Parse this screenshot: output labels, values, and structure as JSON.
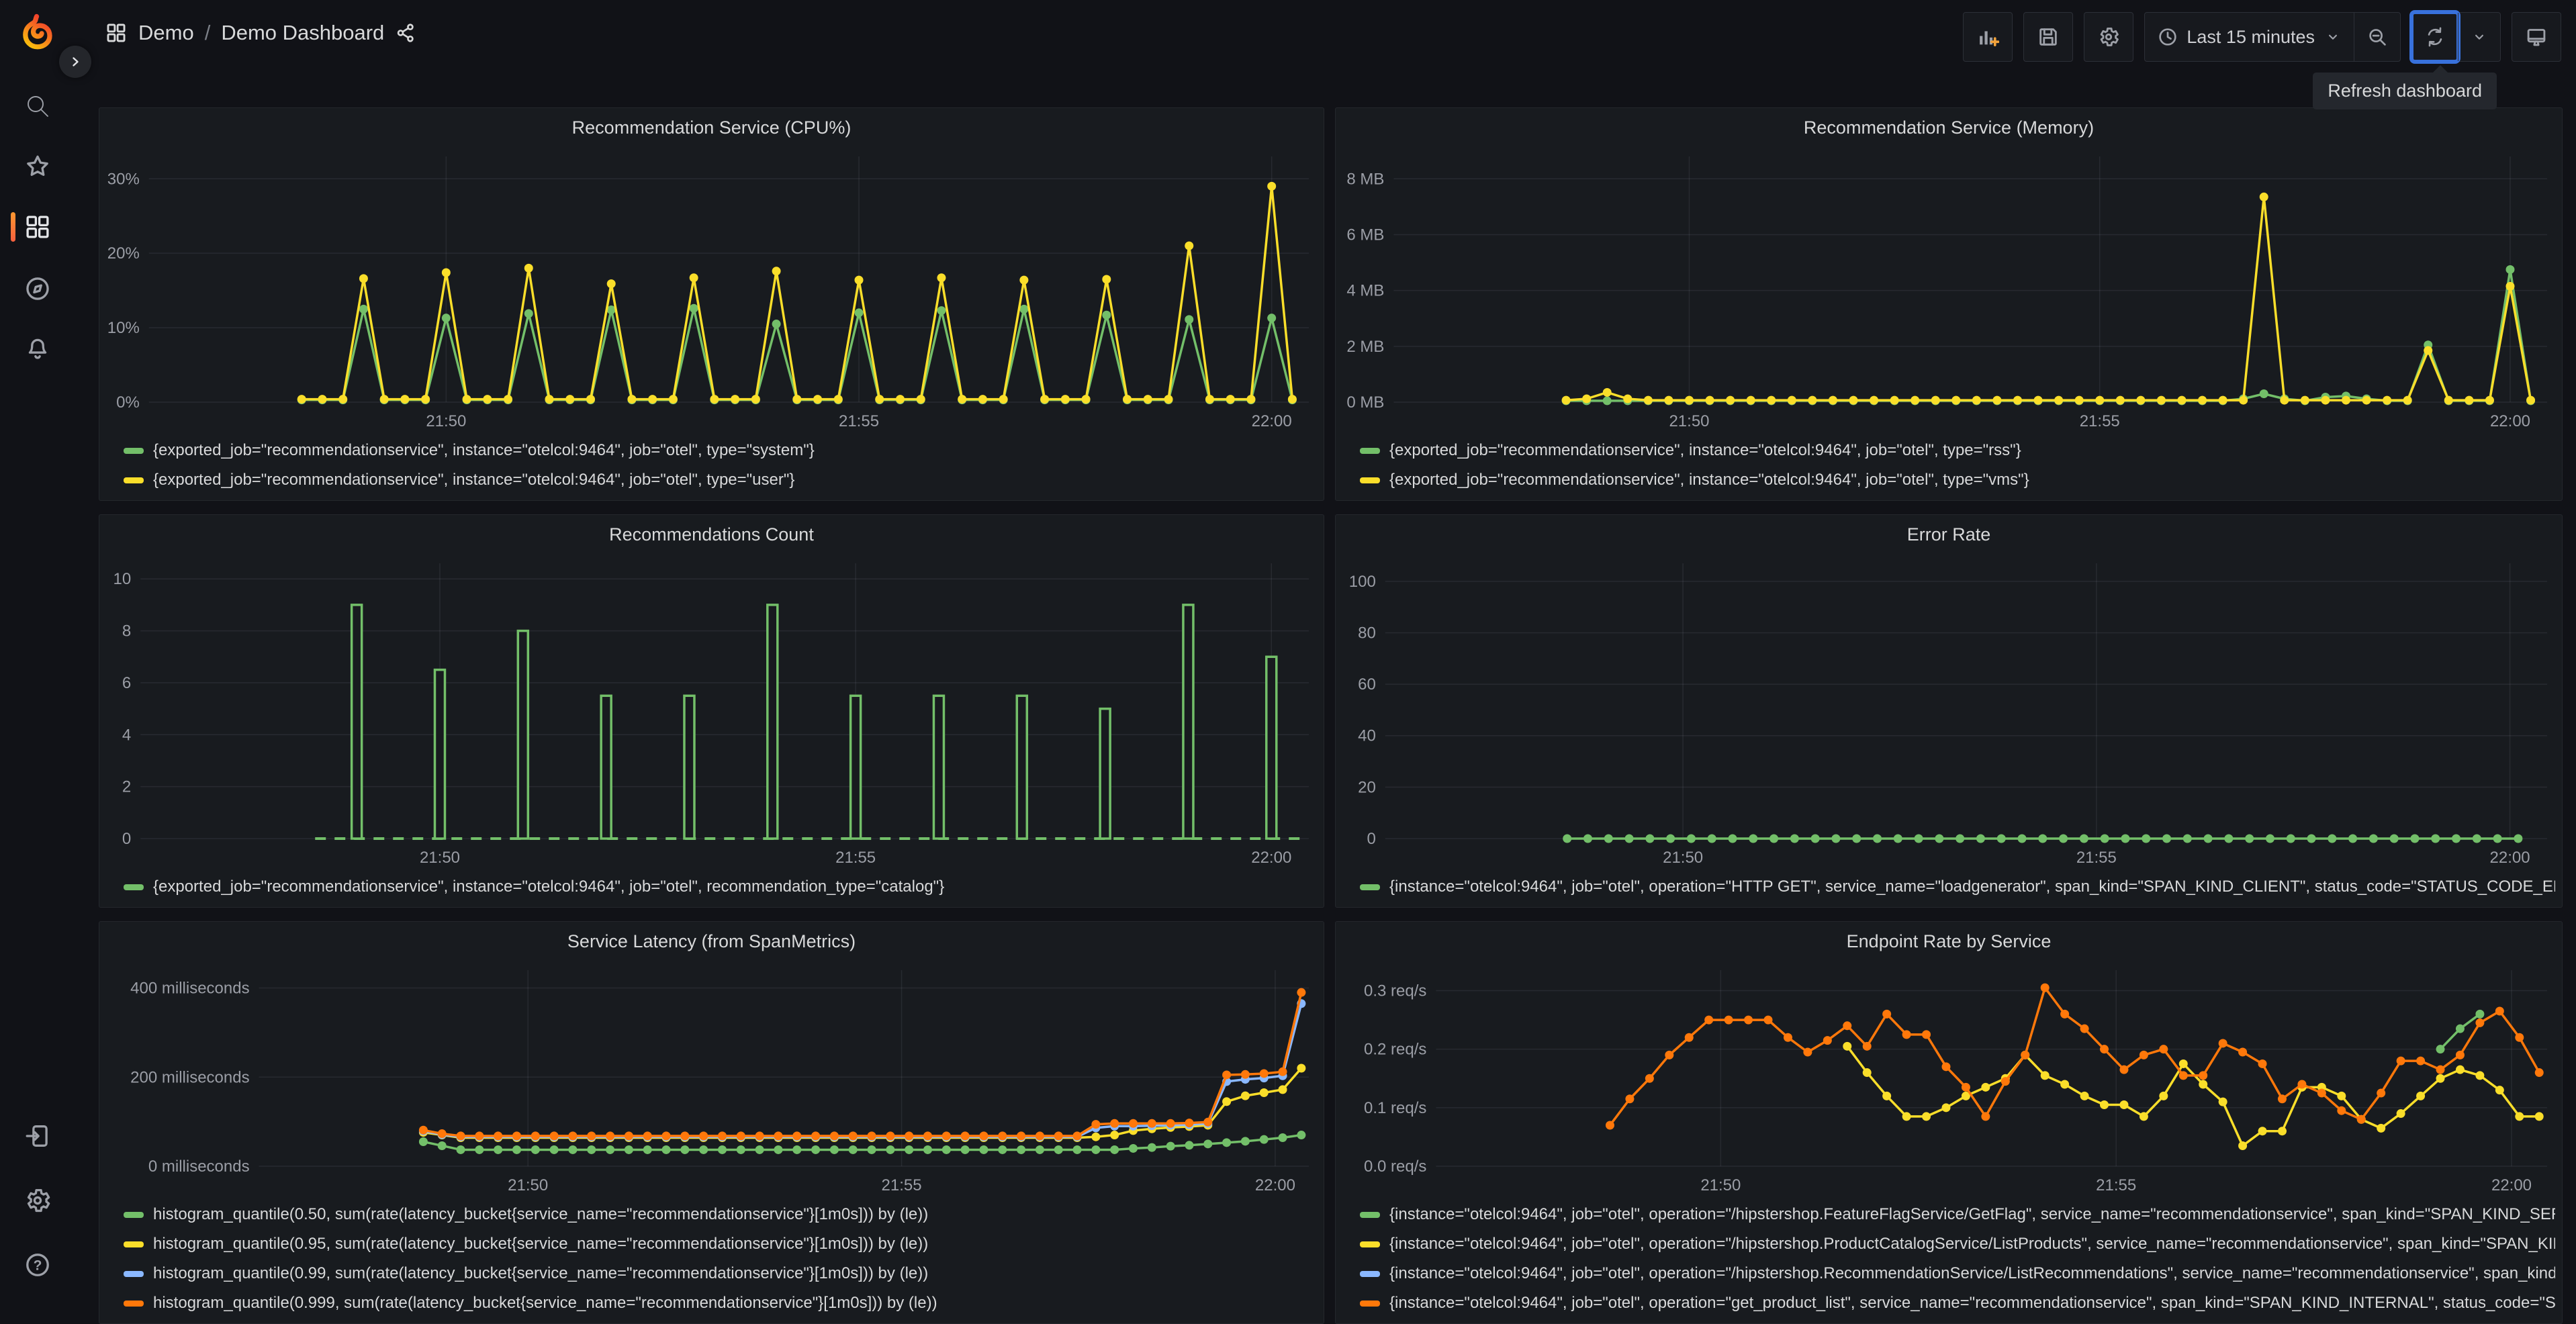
{
  "nav": {
    "breadcrumb": {
      "root": "Demo",
      "separator": "/",
      "page": "Demo Dashboard"
    }
  },
  "toolbar": {
    "time_range": {
      "label": "Last 15 minutes"
    }
  },
  "tooltip": {
    "text": "Refresh dashboard"
  },
  "colors": {
    "green": "#73BF69",
    "yellow": "#FADE2A",
    "blue": "#8AB8FF",
    "orange": "#FF780A",
    "accent": "#FF780A",
    "focus": "#3871DC"
  },
  "chart_data": [
    {
      "type": "line",
      "title": "Recommendation Service (CPU%)",
      "xlabel": "",
      "ylabel": "",
      "y_max": 33,
      "y_ticks": [
        {
          "v": 0,
          "label": "0%"
        },
        {
          "v": 10,
          "label": "10%"
        },
        {
          "v": 20,
          "label": "20%"
        },
        {
          "v": 30,
          "label": "30%"
        }
      ],
      "x_ticks": [
        {
          "t": 4,
          "label": "21:50"
        },
        {
          "t": 9,
          "label": "21:55"
        },
        {
          "t": 14,
          "label": "22:00"
        }
      ],
      "t_domain": [
        0.4,
        14.45
      ],
      "series": [
        {
          "name": "{exported_job=\"recommendationservice\", instance=\"otelcol:9464\", job=\"otel\", type=\"system\"}",
          "color": "#73BF69",
          "start": 2.25,
          "step": 0.25,
          "values": [
            0.3,
            0.3,
            0.3,
            12.5,
            0.3,
            0.3,
            0.3,
            11.3,
            0.3,
            0.3,
            0.3,
            11.9,
            0.3,
            0.3,
            0.3,
            12.4,
            0.3,
            0.3,
            0.3,
            12.6,
            0.3,
            0.3,
            0.3,
            10.5,
            0.3,
            0.3,
            0.3,
            12,
            0.3,
            0.3,
            0.3,
            12.3,
            0.3,
            0.3,
            0.3,
            12.5,
            0.3,
            0.3,
            0.3,
            11.7,
            0.3,
            0.3,
            0.3,
            11.1,
            0.3,
            0.3,
            0.3,
            11.3,
            0.3
          ]
        },
        {
          "name": "{exported_job=\"recommendationservice\", instance=\"otelcol:9464\", job=\"otel\", type=\"user\"}",
          "color": "#FADE2A",
          "start": 2.25,
          "step": 0.25,
          "values": [
            0.4,
            0.4,
            0.4,
            16.6,
            0.4,
            0.4,
            0.4,
            17.4,
            0.4,
            0.4,
            0.4,
            18,
            0.4,
            0.4,
            0.4,
            15.9,
            0.4,
            0.4,
            0.4,
            16.7,
            0.4,
            0.4,
            0.4,
            17.6,
            0.4,
            0.4,
            0.4,
            16.4,
            0.4,
            0.4,
            0.4,
            16.7,
            0.4,
            0.4,
            0.4,
            16.4,
            0.4,
            0.4,
            0.4,
            16.5,
            0.4,
            0.4,
            0.4,
            21,
            0.4,
            0.4,
            0.4,
            29,
            0.4
          ]
        }
      ]
    },
    {
      "type": "line",
      "title": "Recommendation Service (Memory)",
      "y_max": 8.8,
      "y_ticks": [
        {
          "v": 0,
          "label": "0 MB"
        },
        {
          "v": 2,
          "label": "2 MB"
        },
        {
          "v": 4,
          "label": "4 MB"
        },
        {
          "v": 6,
          "label": "6 MB"
        },
        {
          "v": 8,
          "label": "8 MB"
        }
      ],
      "x_ticks": [
        {
          "t": 4,
          "label": "21:50"
        },
        {
          "t": 9,
          "label": "21:55"
        },
        {
          "t": 14,
          "label": "22:00"
        }
      ],
      "t_domain": [
        0.4,
        14.45
      ],
      "series": [
        {
          "name": "{exported_job=\"recommendationservice\", instance=\"otelcol:9464\", job=\"otel\", type=\"rss\"}",
          "color": "#73BF69",
          "start": 2.5,
          "step": 0.25,
          "values": [
            0.05,
            0.05,
            0.05,
            0.05,
            0.05,
            0.05,
            0.05,
            0.05,
            0.05,
            0.05,
            0.05,
            0.05,
            0.05,
            0.05,
            0.05,
            0.05,
            0.05,
            0.05,
            0.05,
            0.05,
            0.05,
            0.05,
            0.05,
            0.05,
            0.05,
            0.05,
            0.05,
            0.05,
            0.05,
            0.05,
            0.05,
            0.05,
            0.05,
            0.12,
            0.3,
            0.12,
            0.05,
            0.18,
            0.22,
            0.12,
            0.05,
            0.05,
            2.05,
            0.05,
            0.05,
            0.05,
            4.75,
            0.05
          ]
        },
        {
          "name": "{exported_job=\"recommendationservice\", instance=\"otelcol:9464\", job=\"otel\", type=\"vms\"}",
          "color": "#FADE2A",
          "start": 2.5,
          "step": 0.25,
          "values": [
            0.07,
            0.12,
            0.35,
            0.12,
            0.07,
            0.07,
            0.07,
            0.07,
            0.07,
            0.07,
            0.07,
            0.07,
            0.07,
            0.07,
            0.07,
            0.07,
            0.07,
            0.07,
            0.07,
            0.07,
            0.07,
            0.07,
            0.07,
            0.07,
            0.07,
            0.07,
            0.07,
            0.07,
            0.07,
            0.07,
            0.07,
            0.07,
            0.07,
            0.07,
            7.35,
            0.07,
            0.07,
            0.07,
            0.07,
            0.07,
            0.07,
            0.07,
            1.85,
            0.07,
            0.07,
            0.07,
            4.15,
            0.07
          ]
        }
      ]
    },
    {
      "type": "bar",
      "title": "Recommendations Count",
      "y_max": 10.6,
      "y_ticks": [
        {
          "v": 0,
          "label": "0"
        },
        {
          "v": 2,
          "label": "2"
        },
        {
          "v": 4,
          "label": "4"
        },
        {
          "v": 6,
          "label": "6"
        },
        {
          "v": 8,
          "label": "8"
        },
        {
          "v": 10,
          "label": "10"
        }
      ],
      "x_ticks": [
        {
          "t": 4,
          "label": "21:50"
        },
        {
          "t": 9,
          "label": "21:55"
        },
        {
          "t": 14,
          "label": "22:00"
        }
      ],
      "t_domain": [
        0.4,
        14.45
      ],
      "baseline": {
        "from": 2.5,
        "to": 14.35,
        "dashed": true
      },
      "series": [
        {
          "name": "{exported_job=\"recommendationservice\", instance=\"otelcol:9464\", job=\"otel\", recommendation_type=\"catalog\"}",
          "color": "#73BF69",
          "bars": [
            [
              3,
              9
            ],
            [
              4,
              6.5
            ],
            [
              5,
              8
            ],
            [
              6,
              5.5
            ],
            [
              7,
              5.5
            ],
            [
              8,
              9
            ],
            [
              9,
              5.5
            ],
            [
              10,
              5.5
            ],
            [
              11,
              5.5
            ],
            [
              12,
              5
            ],
            [
              13,
              9
            ],
            [
              14,
              7
            ]
          ]
        }
      ]
    },
    {
      "type": "line",
      "title": "Error Rate",
      "y_max": 107,
      "y_ticks": [
        {
          "v": 0,
          "label": "0"
        },
        {
          "v": 20,
          "label": "20"
        },
        {
          "v": 40,
          "label": "40"
        },
        {
          "v": 60,
          "label": "60"
        },
        {
          "v": 80,
          "label": "80"
        },
        {
          "v": 100,
          "label": "100"
        }
      ],
      "x_ticks": [
        {
          "t": 4,
          "label": "21:50"
        },
        {
          "t": 9,
          "label": "21:55"
        },
        {
          "t": 14,
          "label": "22:00"
        }
      ],
      "t_domain": [
        0.4,
        14.45
      ],
      "series": [
        {
          "name": "{instance=\"otelcol:9464\", job=\"otel\", operation=\"HTTP GET\", service_name=\"loadgenerator\", span_kind=\"SPAN_KIND_CLIENT\", status_code=\"STATUS_CODE_ERROR\"}",
          "color": "#73BF69",
          "start": 2.6,
          "step": 0.25,
          "values": [
            0,
            0,
            0,
            0,
            0,
            0,
            0,
            0,
            0,
            0,
            0,
            0,
            0,
            0,
            0,
            0,
            0,
            0,
            0,
            0,
            0,
            0,
            0,
            0,
            0,
            0,
            0,
            0,
            0,
            0,
            0,
            0,
            0,
            0,
            0,
            0,
            0,
            0,
            0,
            0,
            0,
            0,
            0,
            0,
            0,
            0,
            0
          ]
        }
      ]
    },
    {
      "type": "line",
      "title": "Service Latency (from SpanMetrics)",
      "y_max": 440,
      "y_ticks": [
        {
          "v": 0,
          "label": "0 milliseconds"
        },
        {
          "v": 200,
          "label": "200 milliseconds"
        },
        {
          "v": 400,
          "label": "400 milliseconds"
        }
      ],
      "x_ticks": [
        {
          "t": 4,
          "label": "21:50"
        },
        {
          "t": 9,
          "label": "21:55"
        },
        {
          "t": 14,
          "label": "22:00"
        }
      ],
      "t_domain": [
        0.4,
        14.45
      ],
      "series": [
        {
          "name": "histogram_quantile(0.50, sum(rate(latency_bucket{service_name=\"recommendationservice\"}[1m0s])) by (le))",
          "color": "#73BF69",
          "start": 2.6,
          "step": 0.25,
          "values": [
            55,
            46,
            37,
            37,
            37,
            37,
            37,
            37,
            37,
            37,
            37,
            37,
            37,
            37,
            37,
            37,
            37,
            37,
            37,
            37,
            37,
            37,
            37,
            37,
            37,
            37,
            37,
            37,
            37,
            37,
            37,
            37,
            37,
            37,
            37,
            37,
            37,
            37,
            40,
            42,
            45,
            47,
            50,
            53,
            56,
            60,
            64,
            70
          ]
        },
        {
          "name": "histogram_quantile(0.95, sum(rate(latency_bucket{service_name=\"recommendationservice\"}[1m0s])) by (le))",
          "color": "#FADE2A",
          "start": 2.6,
          "step": 0.25,
          "values": [
            76,
            70,
            64,
            64,
            64,
            64,
            64,
            64,
            64,
            64,
            64,
            64,
            64,
            64,
            64,
            64,
            64,
            64,
            64,
            64,
            64,
            64,
            64,
            64,
            64,
            64,
            64,
            64,
            64,
            64,
            64,
            64,
            64,
            64,
            64,
            64,
            66,
            70,
            80,
            84,
            87,
            89,
            92,
            145,
            158,
            165,
            172,
            220
          ]
        },
        {
          "name": "histogram_quantile(0.99, sum(rate(latency_bucket{service_name=\"recommendationservice\"}[1m0s])) by (le))",
          "color": "#8AB8FF",
          "start": 2.6,
          "step": 0.25,
          "values": [
            79,
            71,
            66,
            66,
            66,
            66,
            66,
            66,
            66,
            66,
            66,
            66,
            66,
            66,
            66,
            66,
            66,
            66,
            66,
            66,
            66,
            66,
            66,
            66,
            66,
            66,
            66,
            66,
            66,
            66,
            66,
            66,
            66,
            66,
            66,
            66,
            86,
            90,
            90,
            91,
            92,
            93,
            96,
            190,
            195,
            198,
            203,
            365
          ]
        },
        {
          "name": "histogram_quantile(0.999, sum(rate(latency_bucket{service_name=\"recommendationservice\"}[1m0s])) by (le))",
          "color": "#FF780A",
          "start": 2.6,
          "step": 0.25,
          "values": [
            81,
            73,
            68,
            68,
            68,
            68,
            68,
            68,
            68,
            68,
            68,
            68,
            68,
            68,
            68,
            68,
            68,
            68,
            68,
            68,
            68,
            68,
            68,
            68,
            68,
            68,
            68,
            68,
            68,
            68,
            68,
            68,
            68,
            68,
            68,
            68,
            94,
            96,
            96,
            96,
            96,
            97,
            99,
            205,
            206,
            208,
            212,
            390
          ]
        }
      ]
    },
    {
      "type": "line",
      "title": "Endpoint Rate by Service",
      "y_max": 0.335,
      "y_ticks": [
        {
          "v": 0,
          "label": "0.0 req/s"
        },
        {
          "v": 0.1,
          "label": "0.1 req/s"
        },
        {
          "v": 0.2,
          "label": "0.2 req/s"
        },
        {
          "v": 0.3,
          "label": "0.3 req/s"
        }
      ],
      "x_ticks": [
        {
          "t": 4,
          "label": "21:50"
        },
        {
          "t": 9,
          "label": "21:55"
        },
        {
          "t": 14,
          "label": "22:00"
        }
      ],
      "t_domain": [
        0.4,
        14.45
      ],
      "series": [
        {
          "name": "{instance=\"otelcol:9464\", job=\"otel\", operation=\"/hipstershop.FeatureFlagService/GetFlag\", service_name=\"recommendationservice\", span_kind=\"SPAN_KIND_SERVER\", status_code=\"STATUS_CODE_UNSET\"}",
          "color": "#73BF69",
          "start": 13.1,
          "step": 0.25,
          "values": [
            0.2,
            0.235,
            0.26
          ]
        },
        {
          "name": "{instance=\"otelcol:9464\", job=\"otel\", operation=\"/hipstershop.ProductCatalogService/ListProducts\", service_name=\"recommendationservice\", span_kind=\"SPAN_KIND_CLIENT\", status_code=\"STATUS_CODE_UNSET\"}",
          "color": "#FADE2A",
          "start": 5.6,
          "step": 0.25,
          "values": [
            0.205,
            0.16,
            0.12,
            0.085,
            0.085,
            0.1,
            0.12,
            0.135,
            0.15,
            0.19,
            0.155,
            0.14,
            0.12,
            0.105,
            0.105,
            0.085,
            0.12,
            0.175,
            0.14,
            0.11,
            0.035,
            0.06,
            0.06,
            0.135,
            0.135,
            0.12,
            0.08,
            0.065,
            0.09,
            0.12,
            0.15,
            0.165,
            0.155,
            0.13,
            0.085,
            0.085
          ]
        },
        {
          "name": "{instance=\"otelcol:9464\", job=\"otel\", operation=\"/hipstershop.RecommendationService/ListRecommendations\", service_name=\"recommendationservice\", span_kind=\"SPAN_KIND_SERVER\", status_code=\"STATUS_CODE_UNSET\"}",
          "color": "#8AB8FF",
          "start": 2.6,
          "step": 0.25,
          "values": []
        },
        {
          "name": "{instance=\"otelcol:9464\", job=\"otel\", operation=\"get_product_list\", service_name=\"recommendationservice\", span_kind=\"SPAN_KIND_INTERNAL\", status_code=\"STATUS_CODE_UNSET\"}",
          "color": "#FF780A",
          "start": 2.6,
          "step": 0.25,
          "values": [
            0.07,
            0.115,
            0.15,
            0.19,
            0.22,
            0.25,
            0.25,
            0.25,
            0.25,
            0.22,
            0.195,
            0.215,
            0.24,
            0.205,
            0.26,
            0.225,
            0.225,
            0.17,
            0.135,
            0.085,
            0.145,
            0.19,
            0.305,
            0.26,
            0.235,
            0.2,
            0.165,
            0.19,
            0.2,
            0.155,
            0.155,
            0.21,
            0.195,
            0.175,
            0.115,
            0.14,
            0.125,
            0.095,
            0.08,
            0.125,
            0.18,
            0.18,
            0.165,
            0.19,
            0.245,
            0.265,
            0.22,
            0.16
          ]
        }
      ]
    }
  ]
}
